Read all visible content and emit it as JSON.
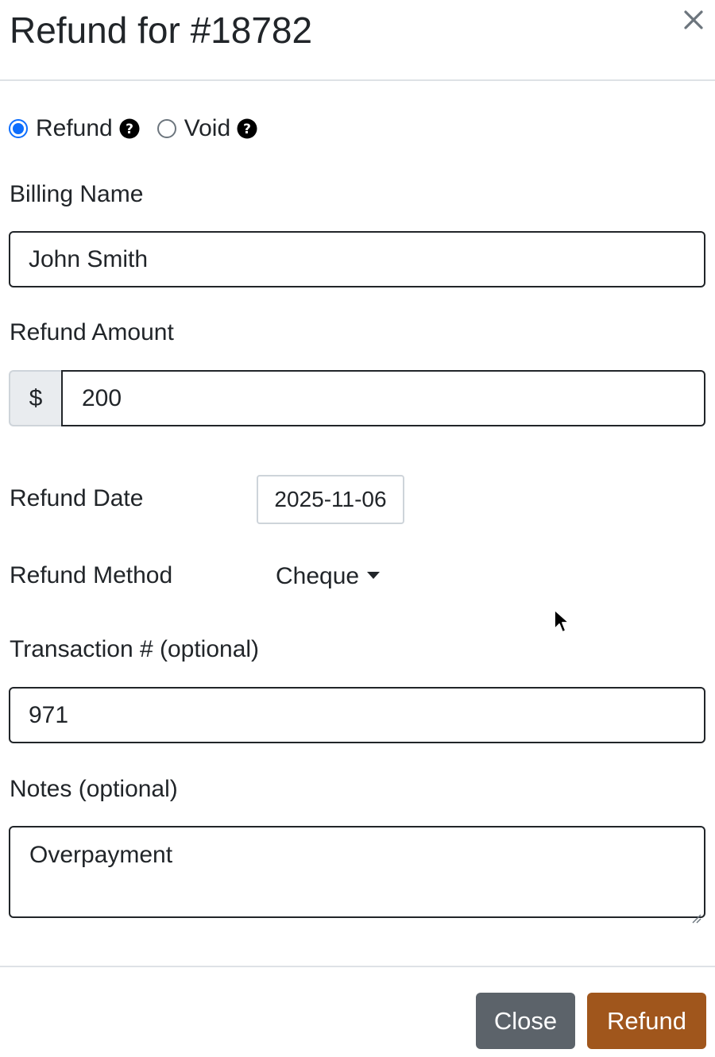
{
  "modal": {
    "title": "Refund for #18782"
  },
  "refund_type": {
    "options": [
      {
        "label": "Refund",
        "checked": true
      },
      {
        "label": "Void",
        "checked": false
      }
    ]
  },
  "billing_name": {
    "label": "Billing Name",
    "value": "John Smith"
  },
  "refund_amount": {
    "label": "Refund Amount",
    "currency_symbol": "$",
    "value": "200"
  },
  "refund_date": {
    "label": "Refund Date",
    "value": "2025-11-06"
  },
  "refund_method": {
    "label": "Refund Method",
    "selected": "Cheque"
  },
  "transaction": {
    "label": "Transaction # (optional)",
    "value": "971"
  },
  "notes": {
    "label": "Notes (optional)",
    "value": "Overpayment"
  },
  "footer": {
    "close_label": "Close",
    "refund_label": "Refund"
  },
  "colors": {
    "radio_accent": "#0d6efd",
    "close_button": "#5c636a",
    "refund_button": "#a0561c",
    "addon_background": "#e9ecef"
  },
  "icons": {
    "close": "close-icon",
    "help": "question-circle-icon",
    "caret": "caret-down-icon",
    "cursor": "mouse-pointer-icon",
    "resize": "resize-handle-icon"
  }
}
